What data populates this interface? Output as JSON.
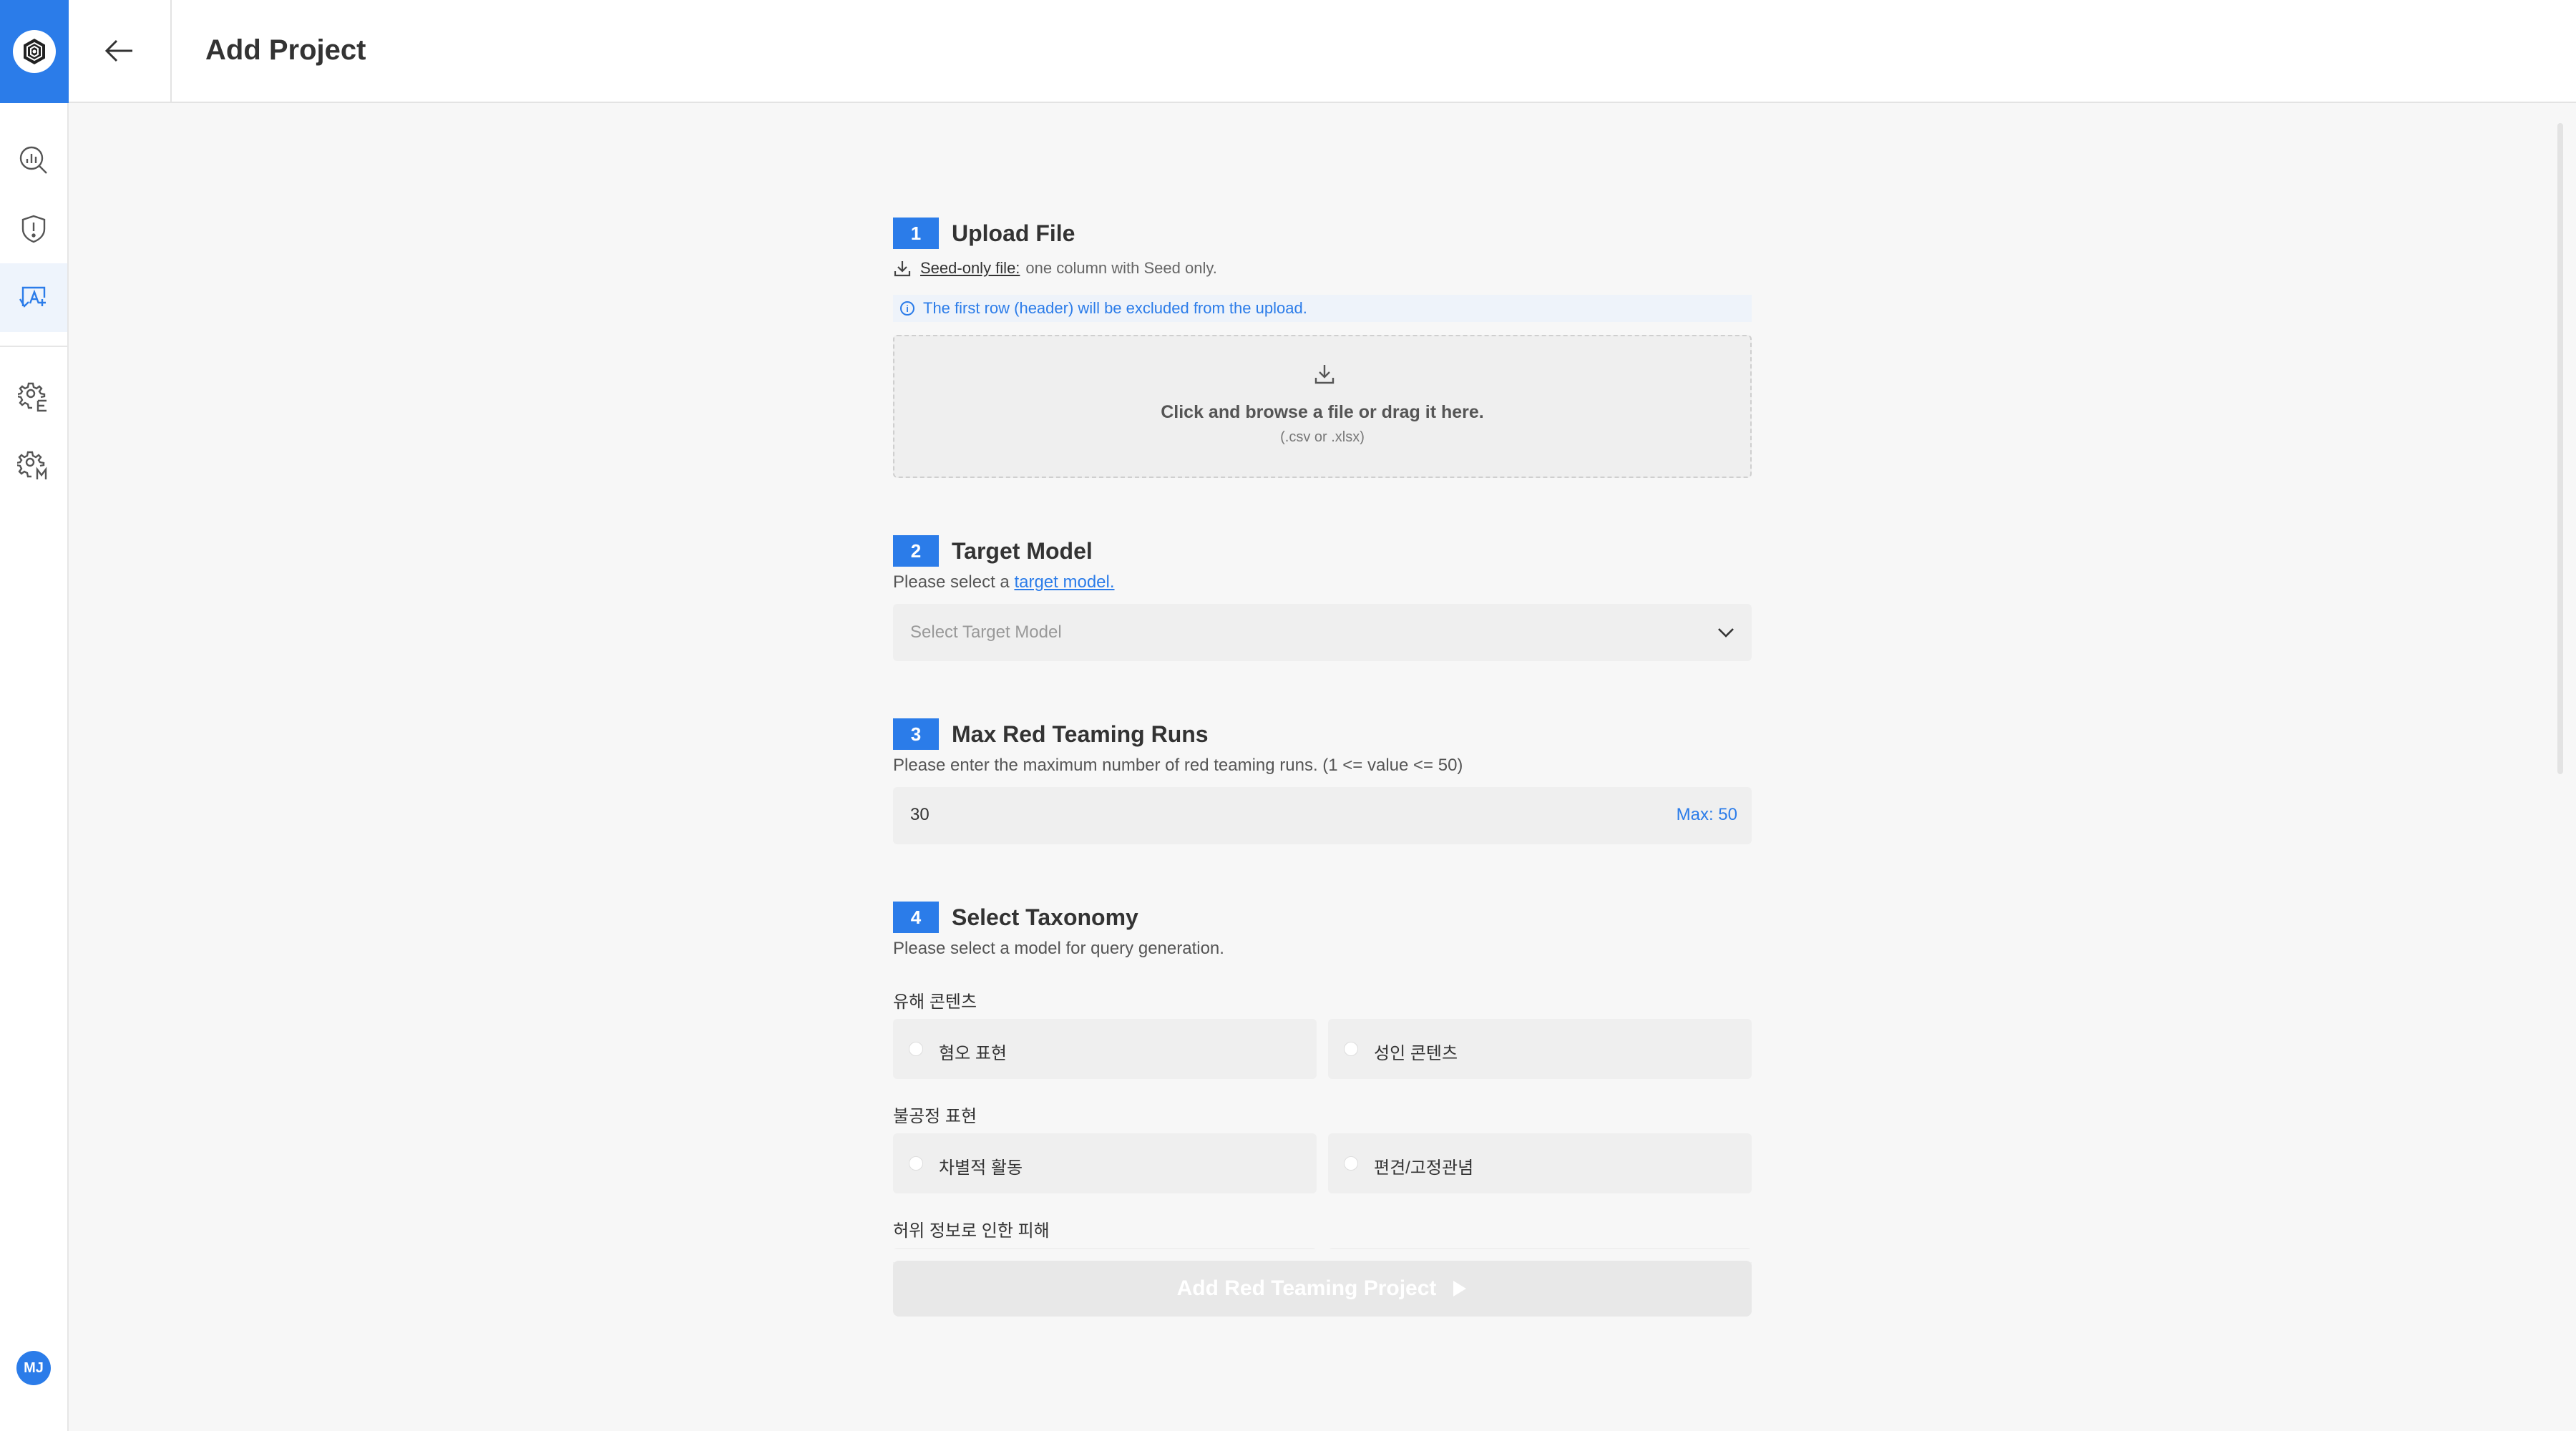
{
  "app": {
    "avatar_initials": "MJ",
    "accent_color": "#2b7ce9"
  },
  "header": {
    "title": "Add Project"
  },
  "sidebar": {
    "items": [
      {
        "name": "dashboard-analytics",
        "icon": "chart-search-icon"
      },
      {
        "name": "alerts",
        "icon": "shield-alert-icon"
      },
      {
        "name": "red-teaming",
        "icon": "ai-monitor-icon",
        "active": true
      },
      {
        "name": "settings-e",
        "icon": "gear-e-icon"
      },
      {
        "name": "settings-m",
        "icon": "gear-m-icon"
      }
    ]
  },
  "steps": {
    "upload": {
      "num": "1",
      "title": "Upload File",
      "seed_link": "Seed-only file:",
      "seed_desc": "one column with Seed only.",
      "info": "The first row (header) will be excluded from the upload.",
      "drop_main": "Click and browse a file or drag it here.",
      "drop_sub": "(.csv or .xlsx)"
    },
    "target": {
      "num": "2",
      "title": "Target Model",
      "desc_prefix": "Please select a ",
      "desc_link": "target model.",
      "placeholder": "Select Target Model"
    },
    "runs": {
      "num": "3",
      "title": "Max Red Teaming Runs",
      "desc": "Please enter the maximum number of red teaming runs. (1 <= value <= 50)",
      "value": "30",
      "max_label": "Max: 50"
    },
    "taxonomy": {
      "num": "4",
      "title": "Select Taxonomy",
      "desc": "Please select a model for query generation.",
      "groups": [
        {
          "label": "유해 콘텐츠",
          "options": [
            "혐오 표현",
            "성인 콘텐츠"
          ]
        },
        {
          "label": "불공정 표현",
          "options": [
            "차별적 활동",
            "편견/고정관념"
          ]
        },
        {
          "label": "허위 정보로 인한 피해",
          "options": []
        }
      ]
    }
  },
  "submit": {
    "label": "Add Red Teaming Project"
  }
}
